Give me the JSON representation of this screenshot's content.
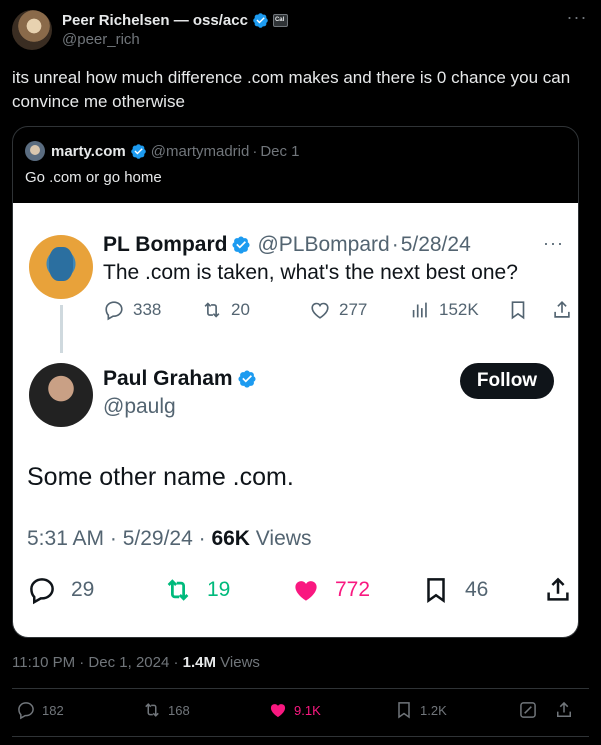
{
  "author": {
    "name": "Peer Richelsen — oss/acc",
    "handle": "@peer_rich",
    "affiliation_badge": "Cal"
  },
  "tweet_text": "its unreal how much difference .com makes and there is 0 chance you can convince me otherwise",
  "quoted": {
    "name": "marty.com",
    "handle": "@martymadrid",
    "separator": "·",
    "date": "Dec 1",
    "text": "Go .com or go home"
  },
  "screenshot": {
    "tweet1": {
      "name": "PL Bompard",
      "handle": "@PLBompard",
      "separator": "·",
      "date": "5/28/24",
      "text": "The .com is taken, what's the next best one?",
      "replies": "338",
      "reposts": "20",
      "likes": "277",
      "views": "152K"
    },
    "tweet2": {
      "name": "Paul Graham",
      "handle": "@paulg",
      "follow_label": "Follow",
      "text": "Some other name .com.",
      "time": "5:31 AM · 5/29/24 · ",
      "views_count": "66K",
      "views_label": " Views",
      "replies": "29",
      "reposts": "19",
      "likes": "772",
      "bookmarks": "46"
    }
  },
  "meta": {
    "time": "11:10 PM · Dec 1, 2024 · ",
    "views_count": "1.4M",
    "views_label": " Views"
  },
  "actions": {
    "replies": "182",
    "reposts": "168",
    "likes": "9.1K",
    "bookmarks": "1.2K"
  },
  "colors": {
    "background": "#000000",
    "text": "#e7e9ea",
    "muted": "#71767b",
    "verified": "#1d9bf0",
    "like": "#f91880",
    "repost": "#00ba7c"
  },
  "icons": [
    "verified-badge-icon",
    "more-icon",
    "reply-icon",
    "repost-icon",
    "like-icon",
    "views-icon",
    "bookmark-icon",
    "share-icon",
    "grok-icon"
  ]
}
